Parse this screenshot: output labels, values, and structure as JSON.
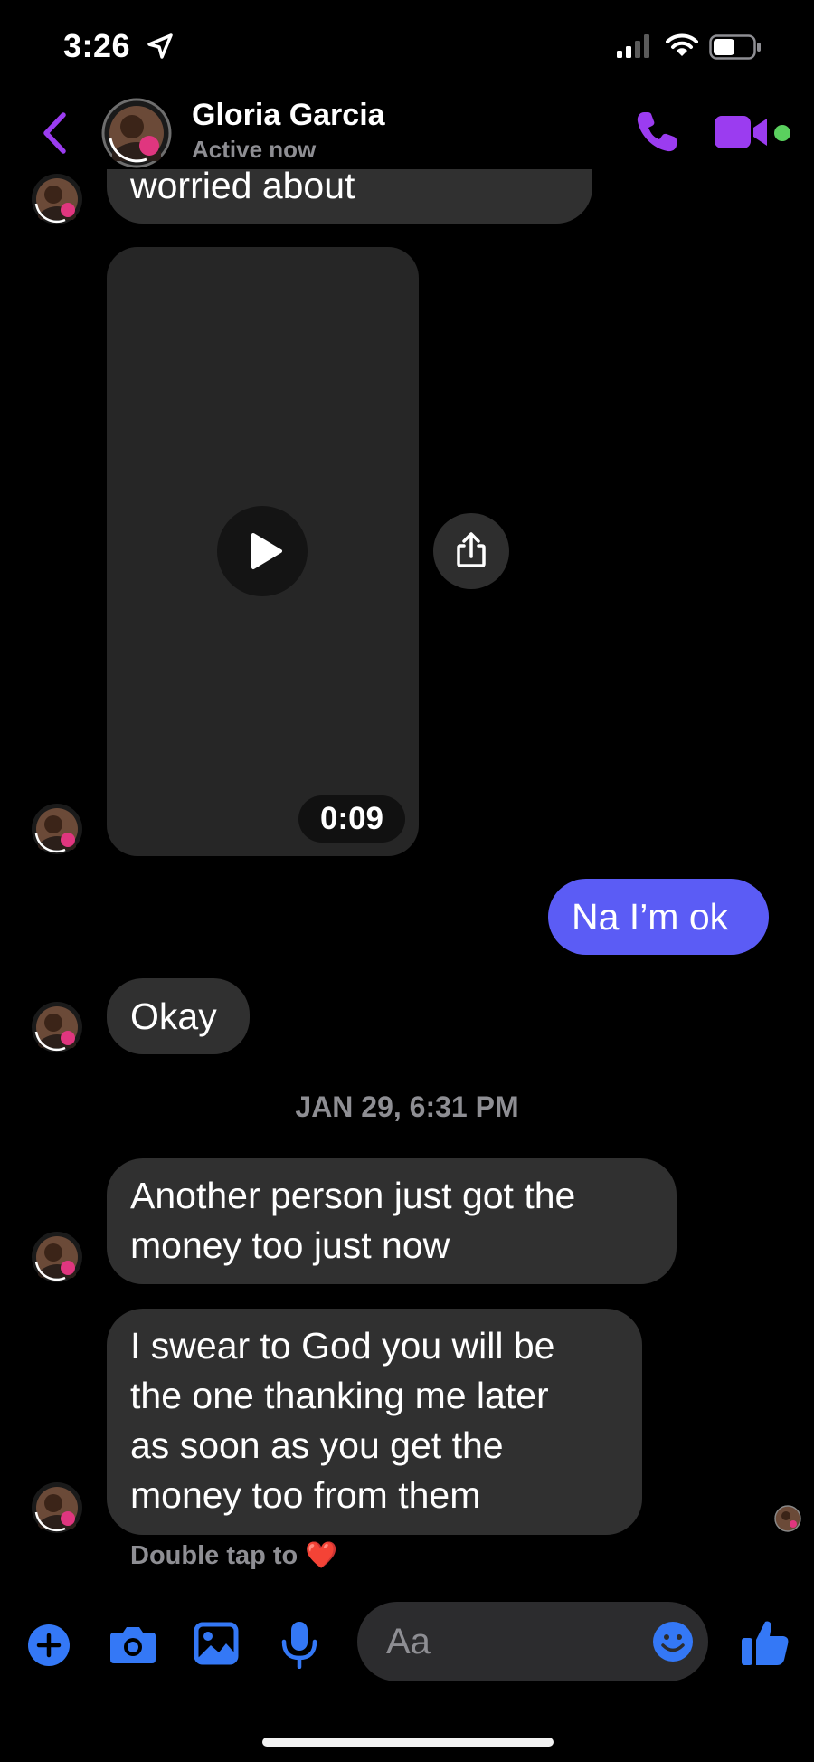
{
  "status_bar": {
    "time": "3:26"
  },
  "header": {
    "contact_name": "Gloria Garcia",
    "status": "Active now"
  },
  "messages": {
    "m1_tail": "worried about",
    "video_duration": "0:09",
    "mine_1": "Na I’m ok",
    "m2": "Okay",
    "timestamp": "JAN 29, 6:31 PM",
    "m3_line1": "Another person just got the",
    "m3_line2": "money too just now",
    "m4_line1": "I swear to God you will be",
    "m4_line2": "the one thanking me later",
    "m4_line3": "as soon as you get the",
    "m4_line4": "money too from them"
  },
  "reaction_hint": {
    "text": "Double tap to",
    "emoji": "❤️"
  },
  "composer": {
    "placeholder": "Aa"
  },
  "colors": {
    "accent": "#9b3cf0",
    "my_bubble": "#5b5cf5",
    "composer_icons": "#3478f6",
    "online": "#5ad05e"
  }
}
